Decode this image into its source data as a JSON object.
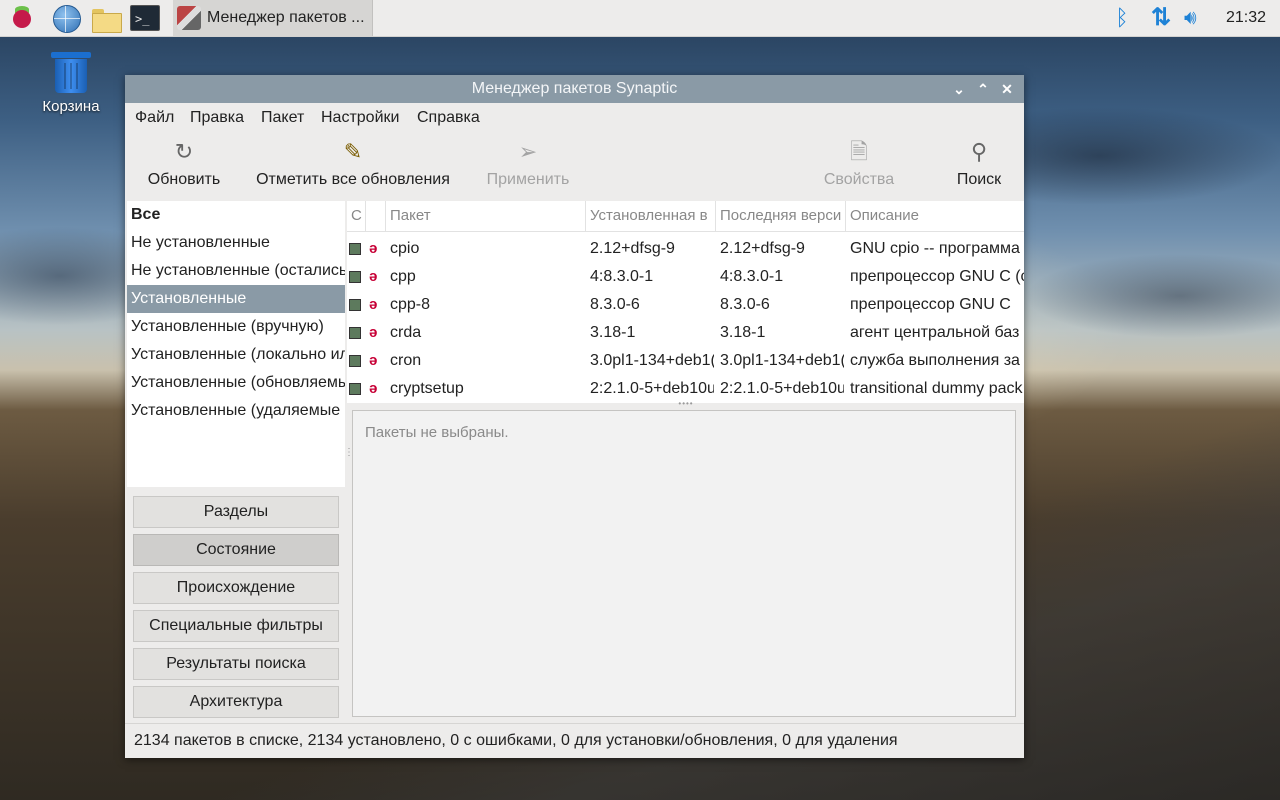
{
  "taskbar": {
    "task_title": "Менеджер пакетов ...",
    "clock": "21:32",
    "icons": [
      "raspberry-menu-icon",
      "browser-icon",
      "file-manager-icon",
      "terminal-icon"
    ],
    "terminal_glyph": ">_"
  },
  "desktop": {
    "trash_label": "Корзина"
  },
  "window": {
    "title": "Менеджер пакетов Synaptic",
    "menu": [
      "Файл",
      "Правка",
      "Пакет",
      "Настройки",
      "Справка"
    ],
    "toolbar": {
      "reload": "Обновить",
      "mark_all": "Отметить все обновления",
      "apply": "Применить",
      "properties": "Свойства",
      "search": "Поиск"
    },
    "filters": [
      "Все",
      "Не установленные",
      "Не установленные (остались",
      "Установленные",
      "Установленные (вручную)",
      "Установленные (локально ил",
      "Установленные (обновляемы",
      "Установленные (удаляемые"
    ],
    "selected_filter": "Установленные",
    "side_buttons": [
      "Разделы",
      "Состояние",
      "Происхождение",
      "Специальные фильтры",
      "Результаты поиска",
      "Архитектура"
    ],
    "active_side_button": "Состояние",
    "columns": {
      "s": "С",
      "package": "Пакет",
      "installed": "Установленная в",
      "latest": "Последняя верси",
      "description": "Описание"
    },
    "packages": [
      {
        "name": "cpio",
        "installed": "2.12+dfsg-9",
        "latest": "2.12+dfsg-9",
        "description": "GNU cpio -- программа"
      },
      {
        "name": "cpp",
        "installed": "4:8.3.0-1",
        "latest": "4:8.3.0-1",
        "description": "препроцессор GNU C (c"
      },
      {
        "name": "cpp-8",
        "installed": "8.3.0-6",
        "latest": "8.3.0-6",
        "description": "препроцессор GNU C"
      },
      {
        "name": "crda",
        "installed": "3.18-1",
        "latest": "3.18-1",
        "description": "агент центральной баз"
      },
      {
        "name": "cron",
        "installed": "3.0pl1-134+deb1(",
        "latest": "3.0pl1-134+deb1(",
        "description": "служба выполнения за"
      },
      {
        "name": "cryptsetup",
        "installed": "2:2.1.0-5+deb10u",
        "latest": "2:2.1.0-5+deb10u",
        "description": "transitional dummy pack"
      }
    ],
    "details_message": "Пакеты не выбраны.",
    "status": "2134 пакетов в списке, 2134 установлено, 0 с ошибками, 0 для установки/обновления, 0 для удаления"
  },
  "colors": {
    "selection": "#8a9aa6",
    "tray_blue": "#1e82d6",
    "debian_red": "#c70036"
  }
}
